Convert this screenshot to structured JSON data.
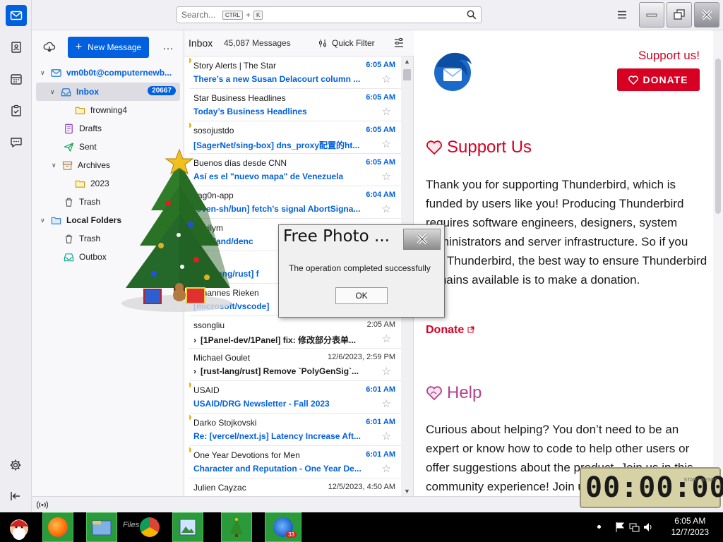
{
  "search": {
    "placeholder": "Search...",
    "shortcut_ctrl": "CTRL",
    "shortcut_plus": "+",
    "shortcut_key": "K"
  },
  "folder_pane": {
    "new_message": "New Message",
    "more": "…",
    "account": "vm0b0t@computernewb...",
    "inbox": {
      "label": "Inbox",
      "count": "20667"
    },
    "folders": [
      "frowning4",
      "Drafts",
      "Sent",
      "Archives",
      "2023",
      "Trash"
    ],
    "local_folders": "Local Folders",
    "local_items": [
      "Trash",
      "Outbox"
    ]
  },
  "list": {
    "title": "Inbox",
    "count": "45,087 Messages",
    "quick_filter": "Quick Filter",
    "messages": [
      {
        "from": "Story Alerts | The Star",
        "date": "6:05 AM",
        "subject": "There’s a new Susan Delacourt column ...",
        "unread": true,
        "today": true
      },
      {
        "from": "Star Business Headlines",
        "date": "6:05 AM",
        "subject": "Today’s Business Headlines",
        "unread": false,
        "today": true
      },
      {
        "from": "sosojustdo",
        "date": "6:05 AM",
        "subject": "[SagerNet/sing-box] dns_proxy配置的ht...",
        "unread": true,
        "today": true
      },
      {
        "from": "Buenos días desde CNN",
        "date": "6:05 AM",
        "subject": "Así es el \"nuevo mapa\" de Venezuela",
        "unread": false,
        "today": true
      },
      {
        "from": "Jag0n-app",
        "date": "6:04 AM",
        "subject": "[oven-sh/bun] fetch's signal AbortSigna...",
        "unread": true,
        "today": true
      },
      {
        "from": "Jswilym",
        "date": "",
        "subject": "[emoland/denc",
        "unread": false,
        "today": true
      },
      {
        "from": "",
        "date": "",
        "subject": "[rust-lang/rust] f",
        "unread": false,
        "today": false
      },
      {
        "from": "Johannes Rieken",
        "date": "",
        "subject": "[microsoft/vscode]",
        "unread": false,
        "today": true
      },
      {
        "from": "ssongliu",
        "date": "2:05 AM",
        "subject": "[1Panel-dev/1Panel] fix: 修改部分表单...",
        "unread": false,
        "today": false,
        "thread": true
      },
      {
        "from": "Michael Goulet",
        "date": "12/6/2023, 2:59 PM",
        "subject": "[rust-lang/rust] Remove `PolyGenSig`...",
        "unread": false,
        "today": false,
        "thread": true
      },
      {
        "from": "USAID",
        "date": "6:01 AM",
        "subject": "USAID/DRG Newsletter - Fall 2023",
        "unread": true,
        "today": true
      },
      {
        "from": "Darko Stojkovski",
        "date": "6:01 AM",
        "subject": "Re: [vercel/next.js] Latency Increase Aft...",
        "unread": true,
        "today": true
      },
      {
        "from": "One Year Devotions for Men",
        "date": "6:01 AM",
        "subject": "Character and Reputation - One Year De...",
        "unread": true,
        "today": true
      },
      {
        "from": "Julien Cayzac",
        "date": "12/5/2023, 4:50 AM",
        "subject": "",
        "unread": false,
        "today": false
      }
    ]
  },
  "content": {
    "support_link": "Support us!",
    "donate_button": "DONATE",
    "support_heading": "Support Us",
    "support_text": "Thank you for supporting Thunderbird, which is funded by users like you! Producing Thunderbird requires software engineers, designers, system administrators and server infrastructure. So if you like Thunderbird, the best way to ensure Thunderbird remains available is to make a donation.",
    "donate_link": "Donate",
    "help_heading": "Help",
    "help_text": "Curious about helping? You don’t need to be an expert or know how to code to help other users or offer suggestions about the product. Join us in this community experience! Join us in this"
  },
  "dialog": {
    "title": "Free Photo ...",
    "message": "The operation completed successfully",
    "ok": "OK"
  },
  "clock": {
    "digits": "00:00:00",
    "side": "START RESET"
  },
  "taskbar": {
    "time": "6:05 AM",
    "date": "12/7/2023",
    "thunderbird_badge": "33",
    "files_label": "Files"
  },
  "colors": {
    "accent": "#0060df",
    "support_red": "#d70022",
    "help_magenta": "#b4418c",
    "taskbar_green": "#2a9a3a"
  }
}
